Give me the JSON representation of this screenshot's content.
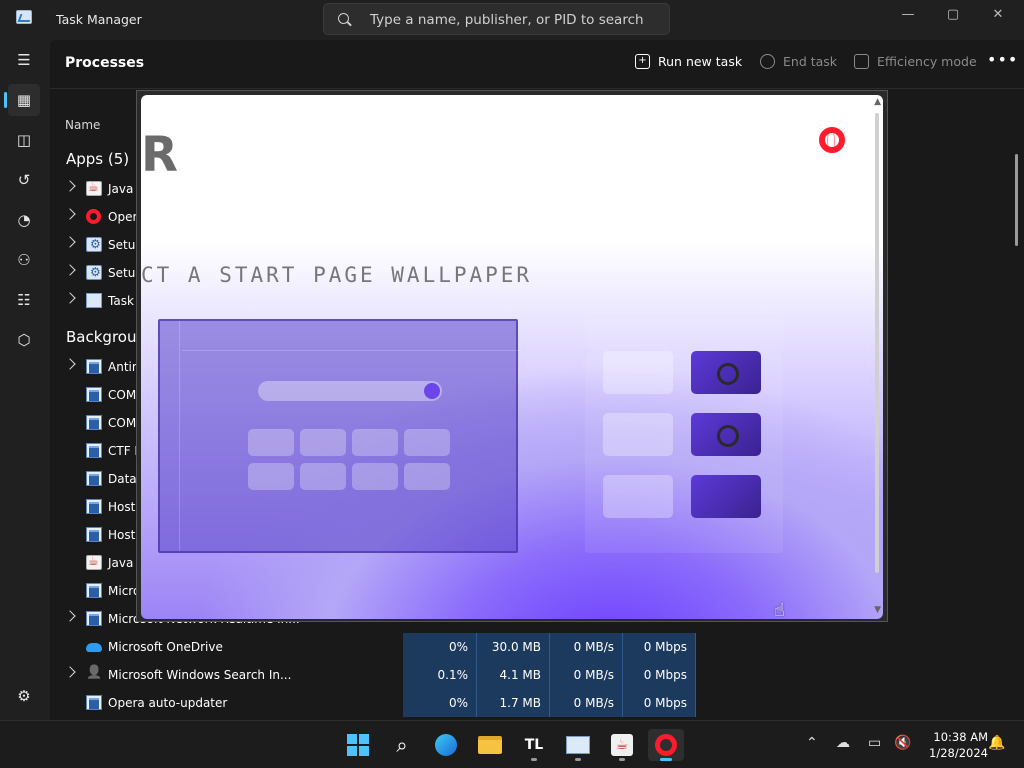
{
  "window": {
    "title": "Task Manager",
    "search_placeholder": "Type a name, publisher, or PID to search",
    "controls": [
      "—",
      "▢",
      "✕"
    ]
  },
  "toolbar": {
    "page_title": "Processes",
    "run_new_task": "Run new task",
    "end_task": "End task",
    "efficiency_mode": "Efficiency mode",
    "more": "•••"
  },
  "table": {
    "col_name": "Name",
    "apps_section": "Apps (5)",
    "background_section": "Backgrou",
    "apps": [
      {
        "name": "Java P",
        "icon": "java-icon",
        "expand": true
      },
      {
        "name": "Opera",
        "icon": "opera-icon",
        "expand": true
      },
      {
        "name": "Setup",
        "icon": "setup-icon",
        "expand": true
      },
      {
        "name": "Setup",
        "icon": "setup-icon",
        "expand": true
      },
      {
        "name": "Task M",
        "icon": "task-manager-icon",
        "expand": true
      }
    ],
    "background": [
      {
        "name": "Antim",
        "icon": "process-icon",
        "expand": true
      },
      {
        "name": "COM",
        "icon": "process-icon",
        "expand": false
      },
      {
        "name": "COM",
        "icon": "process-icon",
        "expand": false
      },
      {
        "name": "CTF L",
        "icon": "process-icon",
        "expand": false
      },
      {
        "name": "Data",
        "icon": "process-icon",
        "expand": false
      },
      {
        "name": "Host",
        "icon": "process-icon",
        "expand": false
      },
      {
        "name": "Host",
        "icon": "process-icon",
        "expand": false
      },
      {
        "name": "Java I",
        "icon": "java-icon",
        "expand": false
      },
      {
        "name": "Micro",
        "icon": "process-icon",
        "expand": false
      },
      {
        "name": "Microsoft Network Realtime In...",
        "icon": "process-icon",
        "expand": true
      }
    ],
    "visible_rows": [
      {
        "name": "Microsoft OneDrive",
        "icon": "onedrive-icon",
        "expand": false,
        "cpu": "0%",
        "memory": "30.0 MB",
        "disk": "0 MB/s",
        "network": "0 Mbps"
      },
      {
        "name": "Microsoft Windows Search In...",
        "icon": "search-indexer-icon",
        "expand": true,
        "cpu": "0.1%",
        "memory": "4.1 MB",
        "disk": "0 MB/s",
        "network": "0 Mbps"
      },
      {
        "name": "Opera auto-updater",
        "icon": "process-icon",
        "expand": false,
        "cpu": "0%",
        "memory": "1.7 MB",
        "disk": "0 MB/s",
        "network": "0 Mbps"
      }
    ]
  },
  "modal": {
    "brand_letter": "R",
    "heading": "CT A START PAGE WALLPAPER"
  },
  "taskbar": {
    "apps": [
      "start-icon",
      "search-icon",
      "edge-beta-icon",
      "file-explorer-icon",
      "tl-app-icon",
      "task-manager-icon",
      "java-icon",
      "opera-icon"
    ],
    "tl_label": "TL",
    "time": "10:38 AM",
    "date": "1/28/2024"
  },
  "colors": {
    "accent": "#4cc2ff",
    "opera_red": "#ff1b2d",
    "metric_bg": "#1c3a5e"
  }
}
